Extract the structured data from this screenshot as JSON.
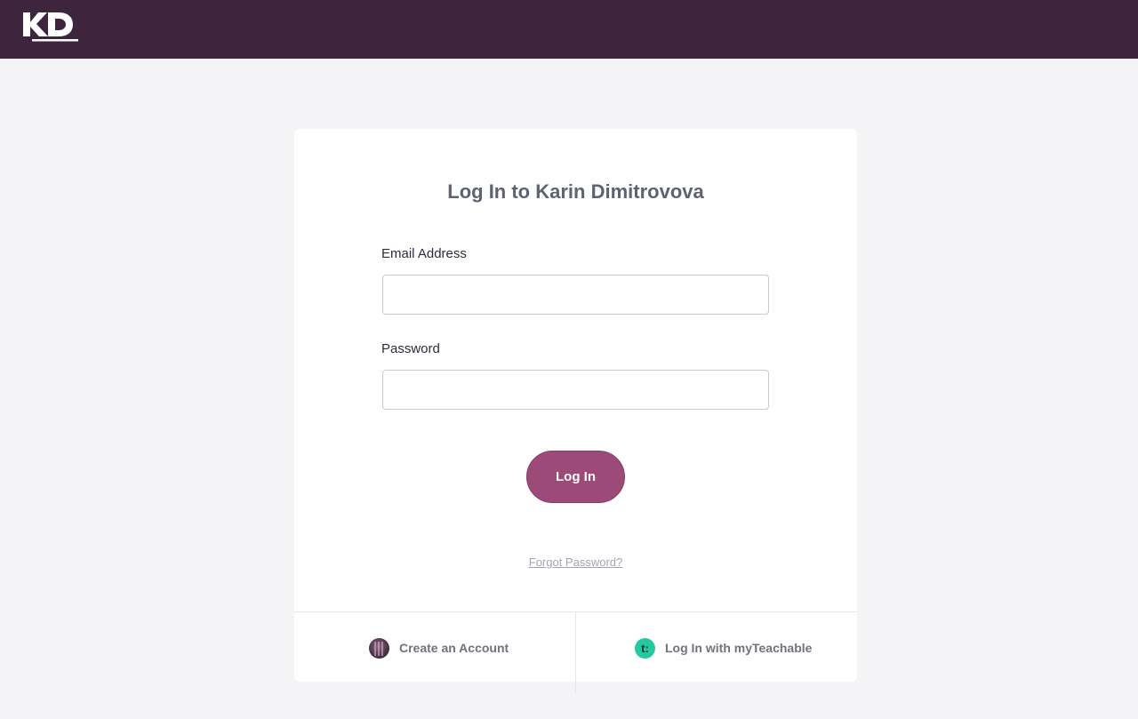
{
  "header": {
    "logo_text": "KD",
    "bg_color": "#3e253d"
  },
  "login": {
    "title": "Log In to Karin Dimitrovova",
    "email_label": "Email Address",
    "email_value": "",
    "password_label": "Password",
    "password_value": "",
    "submit_label": "Log In",
    "forgot_label": "Forgot Password?",
    "accent_color": "#9c4a78"
  },
  "footer": {
    "create_account_label": "Create an Account",
    "create_account_icon": "avatar-icon",
    "myteachable_label": "Log In with myTeachable",
    "myteachable_icon": "teachable-icon",
    "myteachable_icon_glyph": "t:"
  }
}
